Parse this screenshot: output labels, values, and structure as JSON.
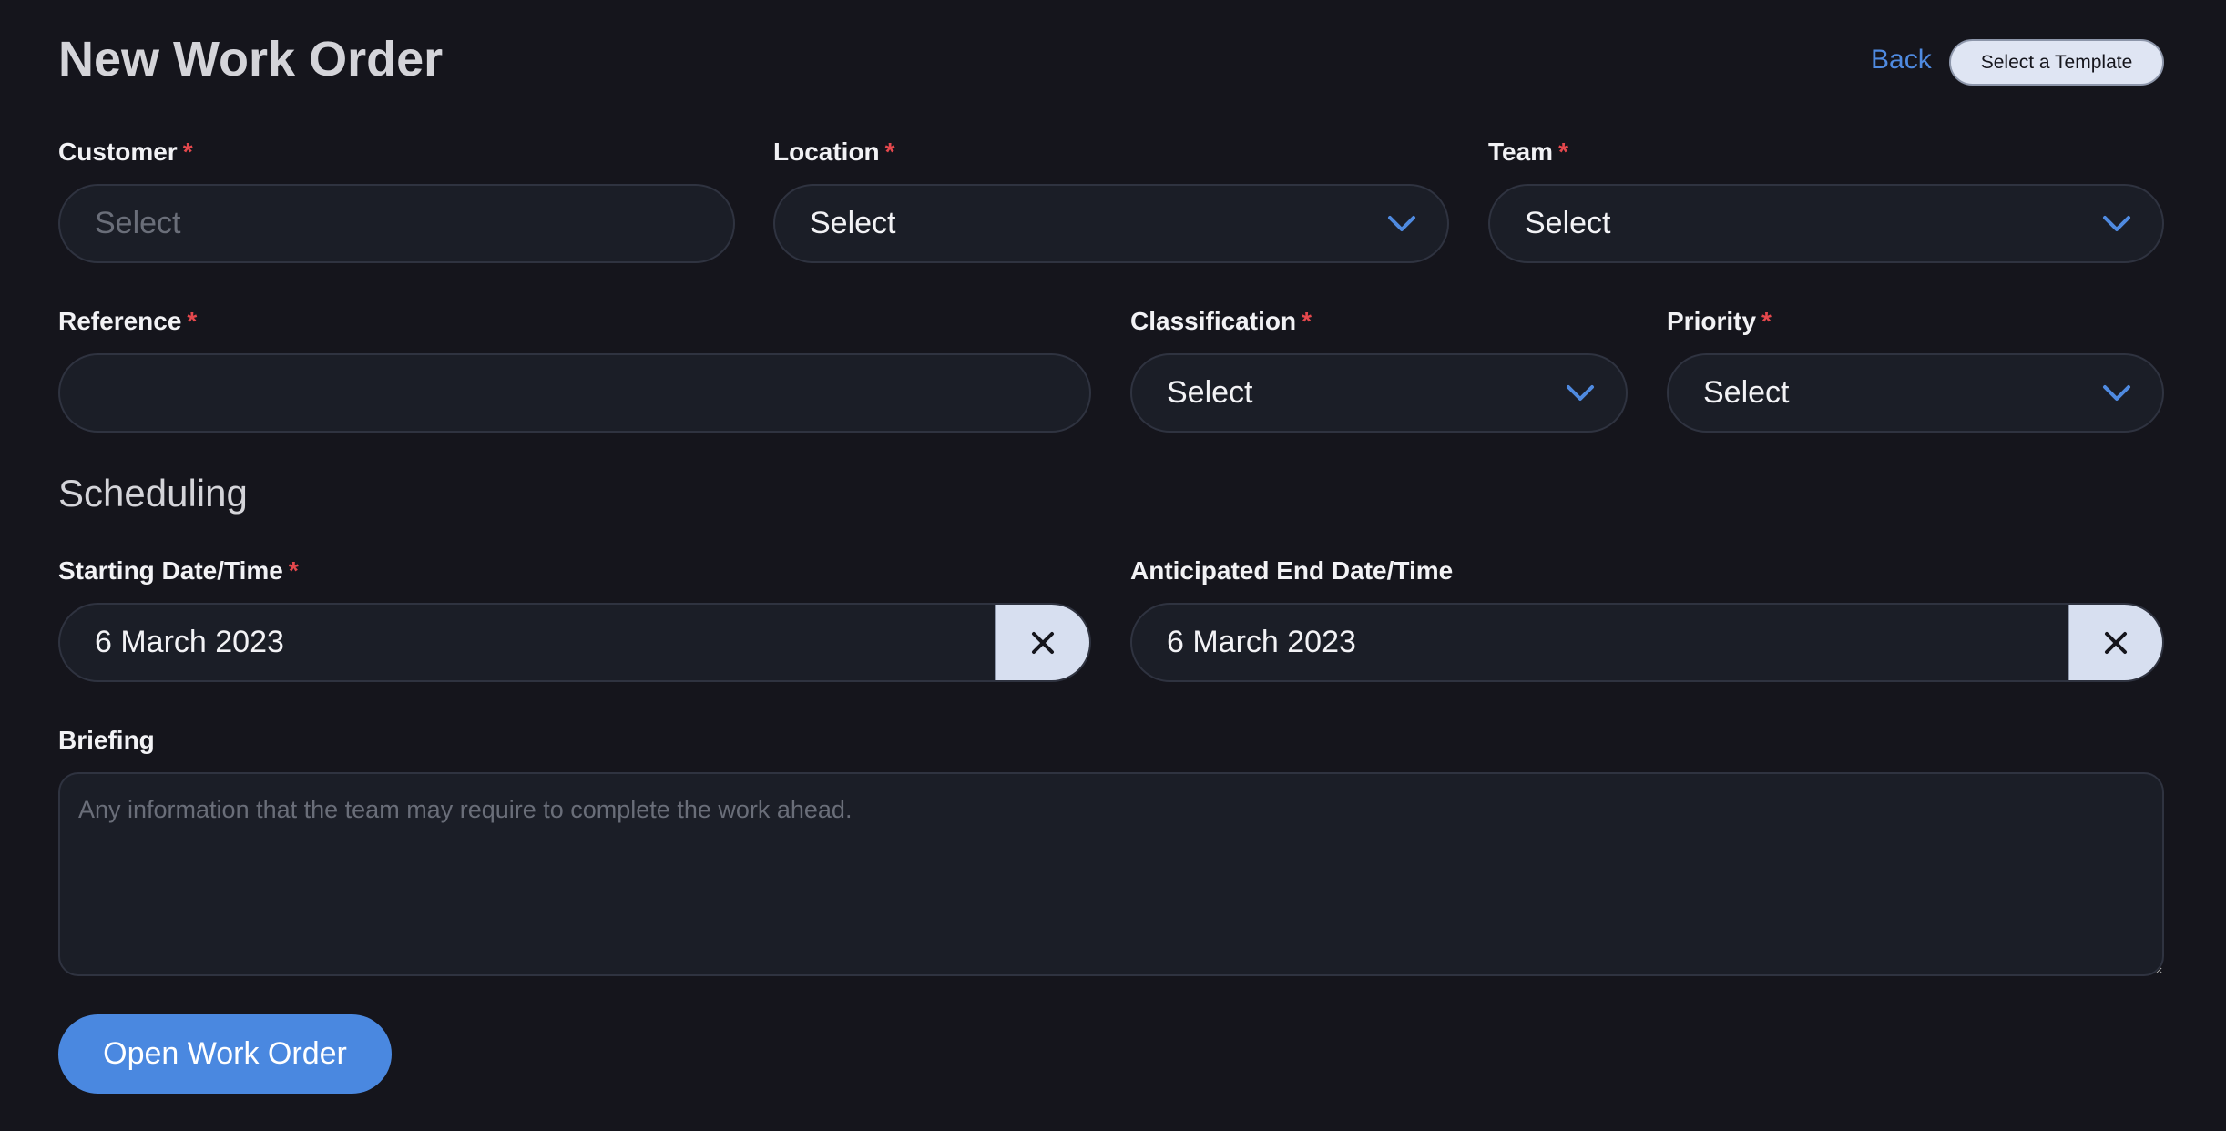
{
  "header": {
    "title": "New Work Order",
    "back_label": "Back",
    "template_label": "Select a Template"
  },
  "fields": {
    "customer": {
      "label": "Customer",
      "required_mark": "*",
      "placeholder": "Select"
    },
    "location": {
      "label": "Location",
      "required_mark": "*",
      "value": "Select"
    },
    "team": {
      "label": "Team",
      "required_mark": "*",
      "value": "Select"
    },
    "reference": {
      "label": "Reference",
      "required_mark": "*",
      "value": ""
    },
    "classification": {
      "label": "Classification",
      "required_mark": "*",
      "value": "Select"
    },
    "priority": {
      "label": "Priority",
      "required_mark": "*",
      "value": "Select"
    }
  },
  "scheduling": {
    "heading": "Scheduling",
    "start": {
      "label": "Starting Date/Time",
      "required_mark": "*",
      "value": "6 March 2023"
    },
    "end": {
      "label": "Anticipated End Date/Time",
      "value": "6 March 2023"
    }
  },
  "briefing": {
    "label": "Briefing",
    "placeholder": "Any information that the team may require to complete the work ahead."
  },
  "submit_label": "Open Work Order",
  "colors": {
    "background": "#15151c",
    "field_background": "#1b1e27",
    "accent": "#4a88e0",
    "required": "#e5484d"
  },
  "icons": {
    "dropdown": "chevron-down-icon",
    "clear": "close-icon"
  }
}
